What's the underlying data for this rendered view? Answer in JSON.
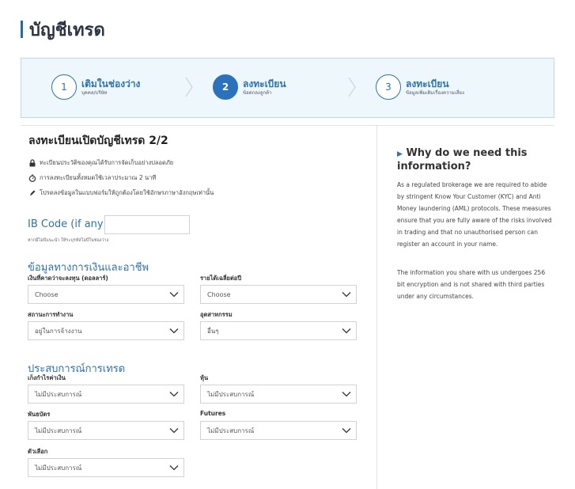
{
  "page": {
    "title": "บัญชีเทรด"
  },
  "stepper": {
    "steps": [
      {
        "number": "1",
        "title": "เติมในช่องว่าง",
        "subtitle": "บุคคล/บริษัท"
      },
      {
        "number": "2",
        "title": "ลงทะเบียน",
        "subtitle": "ข้อตกลงลูกค้า"
      },
      {
        "number": "3",
        "title": "ลงทะเบียน",
        "subtitle": "ข้อมูลเพิ่มเติมเรื่องความเสี่ยง"
      }
    ]
  },
  "form": {
    "title": "ลงทะเบียนเปิดบัญชีเทรด 2/2",
    "notes": [
      {
        "icon": "lock-icon",
        "text": "ทะเบียนประวัติของคุณได้รับการจัดเก็บอย่างปลอดภัย"
      },
      {
        "icon": "stopwatch-icon",
        "text": "การลงทะเบียนทั้งหมดใช้เวลาประมาณ 2 นาที"
      },
      {
        "icon": "pen-icon",
        "text": "โปรดลงข้อมูลในแบบฟอร์มให้ถูกต้องโดยใช้อักษรภาษาอังกฤษเท่านั้น"
      }
    ],
    "ib_code": {
      "label": "IB Code (if any)",
      "value": "",
      "help": "หากมีไอบีแนะนำ ให้ระบุรหัสไอบีในช่องว่าง"
    },
    "financial": {
      "title": "ข้อมูลทางการเงินและอาชีพ",
      "investment_label": "เงินที่คาดว่าจะลงทุน (ดอลลาร์)",
      "investment_value": "Choose",
      "income_label": "รายได้เฉลี่ยต่อปี",
      "income_value": "Choose",
      "employment_label": "สถานะการทำงาน",
      "employment_value": "อยู่ในการจ้างงาน",
      "industry_label": "อุตสาหกรรม",
      "industry_value": "อื่นๆ"
    },
    "experience": {
      "title": "ประสบการณ์การเทรด",
      "forex_label": "เก็งกำไรค่าเงิน",
      "forex_value": "ไม่มีประสบการณ์",
      "stocks_label": "หุ้น",
      "stocks_value": "ไม่มีประสบการณ์",
      "bonds_label": "พันธบัตร",
      "bonds_value": "ไม่มีประสบการณ์",
      "futures_label": "Futures",
      "futures_value": "ไม่มีประสบการณ์",
      "options_label": "ตัวเลือก",
      "options_value": "ไม่มีประสบการณ์"
    }
  },
  "sidebar": {
    "title": "Why do we need this information?",
    "p1": "As a regulated brokerage we are required to abide by stringent Know Your Customer (KYC) and Anti Money laundering (AML) protocols. These measures ensure that you are fully aware of the risks involved in trading and that no unauthorised person can register an account in your name.",
    "p2": "The information you share with us undergoes 256 bit encryption and is not shared with third parties under any circumstances."
  },
  "colors": {
    "accent": "#2a72bd",
    "stepper_bg": "#eef7fb",
    "stepper_border": "#b9dbe9"
  }
}
